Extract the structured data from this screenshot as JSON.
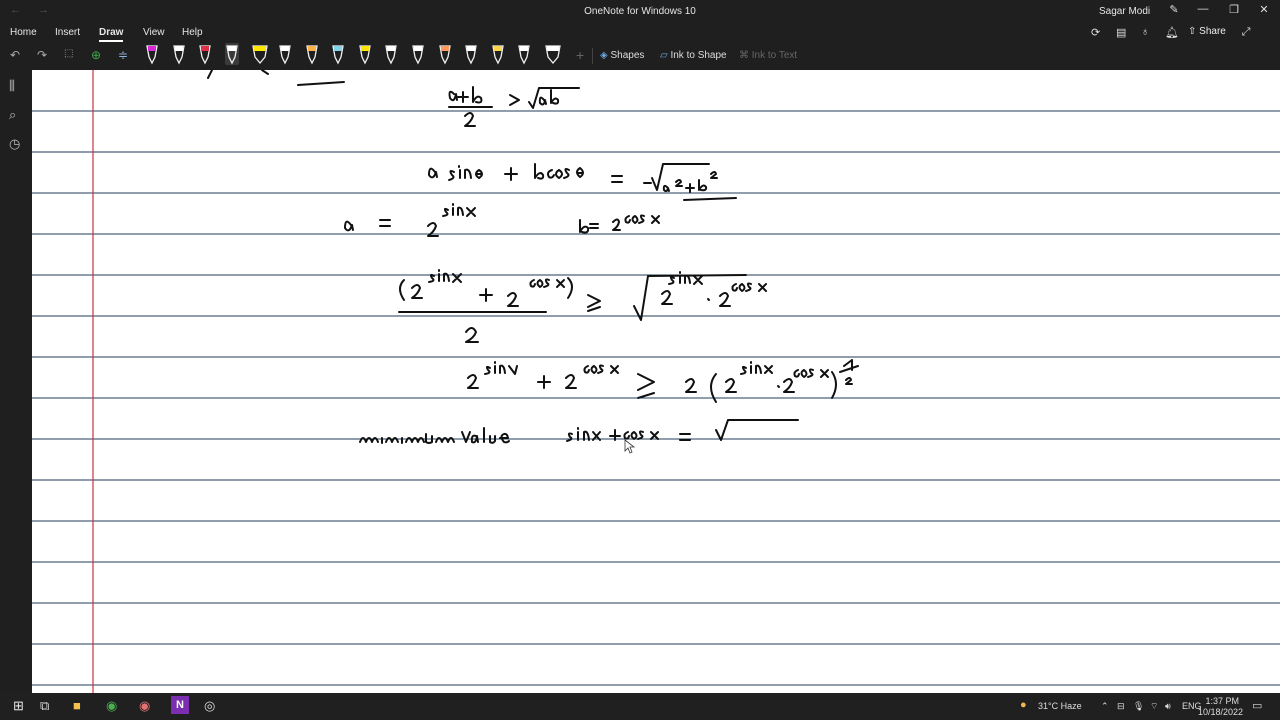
{
  "window": {
    "title": "OneNote for Windows 10",
    "user": "Sagar Modi"
  },
  "menu": {
    "items": [
      "Home",
      "Insert",
      "Draw",
      "View",
      "Help"
    ],
    "active": "Draw"
  },
  "toolbar": {
    "shapes_label": "Shapes",
    "ink_to_shape_label": "Ink to Shape",
    "ink_to_text_label": "Ink to Text",
    "share_label": "Share",
    "pens": [
      {
        "color": "#d62ad6",
        "kind": "pen"
      },
      {
        "color": "#ffffff",
        "kind": "pen"
      },
      {
        "color": "#e0304a",
        "kind": "pen"
      },
      {
        "color": "#ffffff",
        "kind": "pen",
        "selected": true
      },
      {
        "color": "#ffe600",
        "kind": "highlighter"
      },
      {
        "color": "#ffffff",
        "kind": "pen"
      },
      {
        "color": "#ffb347",
        "kind": "pen"
      },
      {
        "color": "#7fd6e8",
        "kind": "pen"
      },
      {
        "color": "#ffe600",
        "kind": "pen"
      },
      {
        "color": "#ffffff",
        "kind": "pen"
      },
      {
        "color": "#ffffff",
        "kind": "pen"
      },
      {
        "color": "#ff9a5a",
        "kind": "pen"
      },
      {
        "color": "#ffffff",
        "kind": "pen"
      },
      {
        "color": "#ffd54a",
        "kind": "pen"
      },
      {
        "color": "#ffffff",
        "kind": "pen"
      },
      {
        "color": "#ffffff",
        "kind": "highlighter"
      }
    ]
  },
  "page": {
    "background": "#ffffff",
    "rule_color": "#1f3b5a",
    "margin_color": "#c8323c",
    "ink": [
      "(a+b)/2 ≥ √ab",
      "a sinθ + b cosθ = −√(a²+b²)",
      "a = 2^sinx   b = 2^cosx",
      "(2^sinx + 2^cosx)/2 ≥ √(2^sinx · 2^cosx)",
      "2^sinx + 2^cosx ≥ 2(2^sinx · 2^cosx)^½",
      "minimum value   sinx + cosx = √"
    ]
  },
  "taskbar": {
    "weather": "31°C  Haze",
    "language": "ENG",
    "time": "1:37 PM",
    "date": "10/18/2022"
  }
}
